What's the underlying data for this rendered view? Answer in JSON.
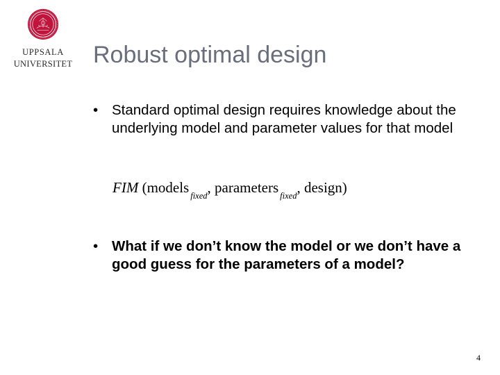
{
  "brand": {
    "line1": "UPPSALA",
    "line2": "UNIVERSITET",
    "color": "#c0143c"
  },
  "slide": {
    "title": "Robust optimal design",
    "title_color": "#696f7a",
    "bullets": [
      {
        "symbol": "•",
        "text": "Standard optimal design requires knowledge about the underlying model and parameter values for that model"
      },
      {
        "symbol": "•",
        "text": "What if we don’t know the model or we don’t have a good guess for the parameters of a model?"
      }
    ],
    "formula": {
      "fim": "FIM",
      "open": "(models",
      "sub1": "fixed",
      "mid": ", parameters",
      "sub2": "fixed",
      "end": ", design)"
    },
    "page_number": "4"
  }
}
